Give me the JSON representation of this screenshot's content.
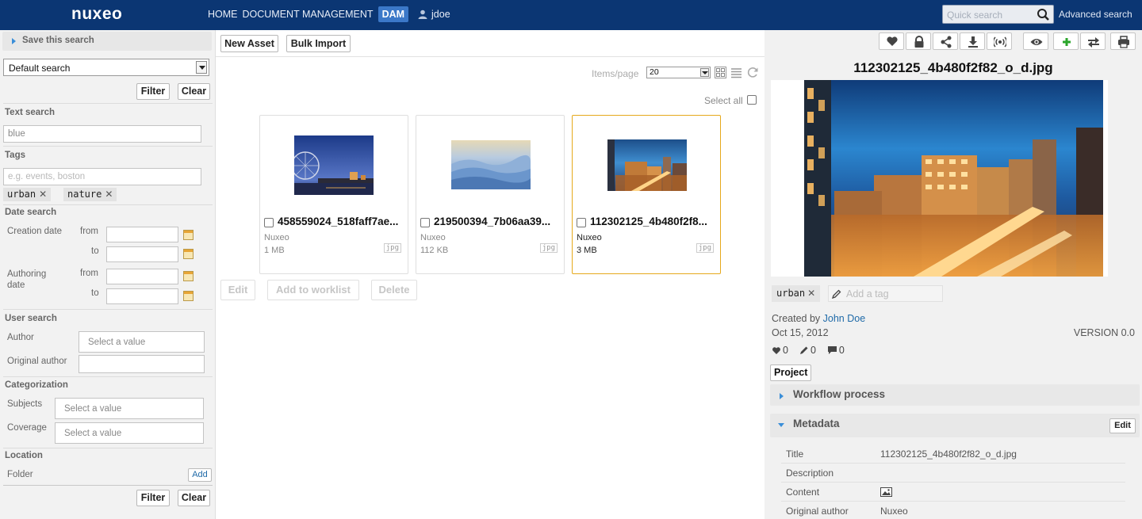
{
  "topbar": {
    "logo": "nuxeo",
    "nav": [
      "HOME",
      "DOCUMENT MANAGEMENT",
      "DAM"
    ],
    "user": "jdoe",
    "quick_search_placeholder": "Quick search",
    "advanced_search": "Advanced search"
  },
  "left": {
    "save_search": "Save this search",
    "search_select": "Default search",
    "filter": "Filter",
    "clear": "Clear",
    "text_search_title": "Text search",
    "text_search_value": "blue",
    "tags_title": "Tags",
    "tags_placeholder": "e.g. events, boston",
    "tags": [
      "urban",
      "nature"
    ],
    "date_search_title": "Date search",
    "creation_date": "Creation date",
    "authoring_date": "Authoring date",
    "from": "from",
    "to": "to",
    "user_search_title": "User search",
    "author": "Author",
    "original_author": "Original author",
    "select_value": "Select a value",
    "categorization_title": "Categorization",
    "subjects": "Subjects",
    "coverage": "Coverage",
    "location_title": "Location",
    "folder": "Folder",
    "add": "Add"
  },
  "center": {
    "new_asset": "New Asset",
    "bulk_import": "Bulk Import",
    "items_per_page_label": "Items/page",
    "items_per_page": "20",
    "select_all": "Select all",
    "assets": [
      {
        "name": "458559024_518faff7ae...",
        "creator": "Nuxeo",
        "size": "1 MB",
        "ext": "jpg"
      },
      {
        "name": "219500394_7b06aa39...",
        "creator": "Nuxeo",
        "size": "112 KB",
        "ext": "jpg"
      },
      {
        "name": "112302125_4b480f2f8...",
        "creator": "Nuxeo",
        "size": "3 MB",
        "ext": "jpg"
      }
    ],
    "actions": [
      "Edit",
      "Add to worklist",
      "Delete"
    ]
  },
  "right": {
    "toolbar_icons": [
      "heart-icon",
      "lock-icon",
      "share-icon",
      "download-icon",
      "broadcast-icon",
      "eye-icon",
      "add-icon",
      "swap-icon",
      "print-icon"
    ],
    "title": "112302125_4b480f2f82_o_d.jpg",
    "tag": "urban",
    "add_tag_placeholder": "Add a tag",
    "created_by_label": "Created by",
    "created_by": "John Doe",
    "date": "Oct 15, 2012",
    "version": "VERSION 0.0",
    "likes": "0",
    "edits": "0",
    "comments": "0",
    "project": "Project",
    "workflow": "Workflow process",
    "metadata_title": "Metadata",
    "metadata_edit": "Edit",
    "metadata": [
      {
        "key": "Title",
        "value": "112302125_4b480f2f82_o_d.jpg"
      },
      {
        "key": "Description",
        "value": ""
      },
      {
        "key": "Content",
        "value": ""
      },
      {
        "key": "Original author",
        "value": "Nuxeo"
      }
    ]
  },
  "colors": {
    "topbar": "#0b3673",
    "accent": "#3a8ed8",
    "selected_border": "#e6a91c",
    "link": "#1f6aa8"
  }
}
